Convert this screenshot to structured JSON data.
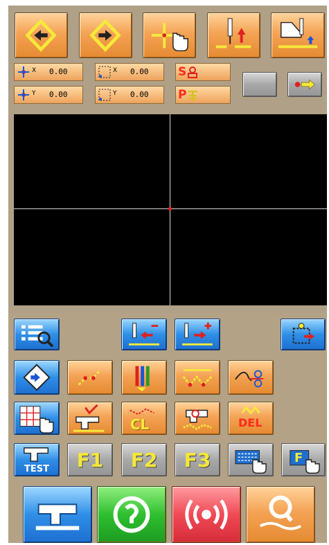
{
  "coords": {
    "x_value": "0.00",
    "y_value": "0.00",
    "rel_x_value": "0.00",
    "rel_y_value": "0.00"
  },
  "status": {
    "speed_label": "S",
    "presser_label": "P"
  },
  "function_keys": {
    "f1": "F1",
    "f2": "F2",
    "f3": "F3",
    "fn_label": "F"
  },
  "labels": {
    "test": "TEST",
    "cl": "CL",
    "del": "DEL"
  },
  "colors": {
    "panel": "#b0a087",
    "button_orange": "#f4a355",
    "button_blue": "#2f8fe6",
    "screen": "#000000",
    "crosshair_center": "#ff2020"
  }
}
